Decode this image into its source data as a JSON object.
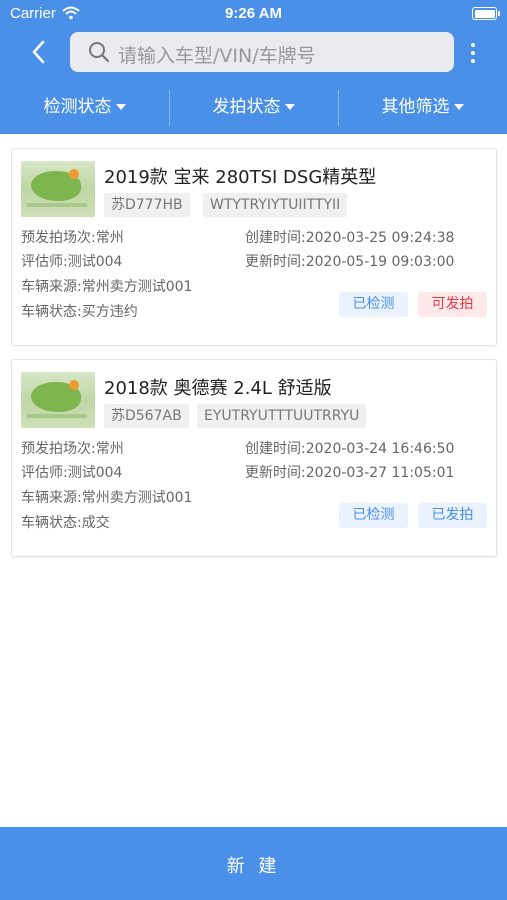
{
  "status_bar": {
    "carrier": "Carrier",
    "time": "9:26 AM"
  },
  "search": {
    "placeholder": "请输入车型/VIN/车牌号"
  },
  "filters": [
    {
      "label": "检测状态"
    },
    {
      "label": "发拍状态"
    },
    {
      "label": "其他筛选"
    }
  ],
  "cards": [
    {
      "title": "2019款 宝来 280TSI DSG精英型",
      "plate": "苏D777HB",
      "vin": "WTYTRYIYTUIITTYII",
      "info": [
        "预发拍场次:常州",
        "创建时间:2020-03-25 09:24:38",
        "评估师:测试004",
        "更新时间:2020-05-19 09:03:00",
        "车辆来源:常州卖方测试001",
        "车辆状态:买方违约"
      ],
      "badges": [
        "已检测",
        "可发拍"
      ]
    },
    {
      "title": "2018款 奥德赛 2.4L 舒适版",
      "plate": "苏D567AB",
      "vin": "EYUTRYUTTTUUTRRYU",
      "info": [
        "预发拍场次:常州",
        "创建时间:2020-03-24 16:46:50",
        "评估师:测试004",
        "更新时间:2020-03-27 11:05:01",
        "车辆来源:常州卖方测试001",
        "车辆状态:成交"
      ],
      "badges": [
        "已检测",
        "已发拍"
      ]
    }
  ],
  "footer": {
    "new_label": "新 建"
  },
  "colors": {
    "primary": "#4a90e8",
    "badge_red": "#e63946",
    "badge_red_bg": "#fde8ea",
    "badge_blue_bg": "#eaf2fd"
  },
  "icons": {
    "back": "chevron-left-icon",
    "search": "search-icon",
    "more": "more-vertical-icon",
    "wifi": "wifi-icon",
    "battery": "battery-icon"
  }
}
